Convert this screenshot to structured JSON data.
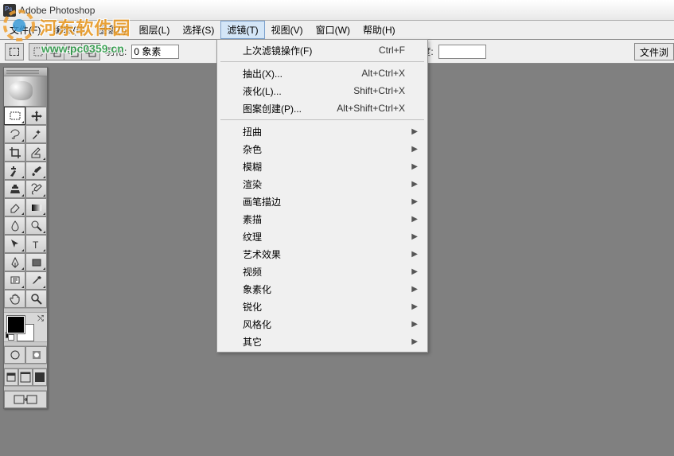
{
  "title": "Adobe Photoshop",
  "menu": {
    "file": "文件(F)",
    "edit": "编辑(E)",
    "image": "图象(I)",
    "layer": "图层(L)",
    "select": "选择(S)",
    "filter": "滤镜(T)",
    "view": "视图(V)",
    "window": "窗口(W)",
    "help": "帮助(H)"
  },
  "options": {
    "feather_label": "羽化:",
    "feather_value": "0 象素",
    "height_label": "高度:",
    "file_browser": "文件浏"
  },
  "dropdown": {
    "last_filter": {
      "label": "上次滤镜操作(F)",
      "accel": "Ctrl+F"
    },
    "extract": {
      "label": "抽出(X)...",
      "accel": "Alt+Ctrl+X"
    },
    "liquify": {
      "label": "液化(L)...",
      "accel": "Shift+Ctrl+X"
    },
    "pattern_maker": {
      "label": "图案创建(P)...",
      "accel": "Alt+Shift+Ctrl+X"
    },
    "distort": "扭曲",
    "noise": "杂色",
    "blur": "模糊",
    "render": "渲染",
    "brush_strokes": "画笔描边",
    "sketch": "素描",
    "texture": "纹理",
    "artistic": "艺术效果",
    "video": "视频",
    "pixelate": "象素化",
    "sharpen": "锐化",
    "stylize": "风格化",
    "other": "其它"
  },
  "watermark": {
    "text": "河东软件园",
    "url": "www.pc0359.cn"
  },
  "tools": {
    "marquee": "rectangular-marquee",
    "move": "move",
    "lasso": "lasso",
    "wand": "magic-wand",
    "crop": "crop",
    "slice": "slice",
    "heal": "healing-brush",
    "brush": "brush",
    "stamp": "clone-stamp",
    "history": "history-brush",
    "eraser": "eraser",
    "gradient": "gradient",
    "blur": "blur",
    "dodge": "dodge",
    "path": "path-selection",
    "type": "type",
    "pen": "pen",
    "shape": "rectangle",
    "notes": "notes",
    "eyedrop": "eyedropper",
    "hand": "hand",
    "zoom": "zoom"
  }
}
